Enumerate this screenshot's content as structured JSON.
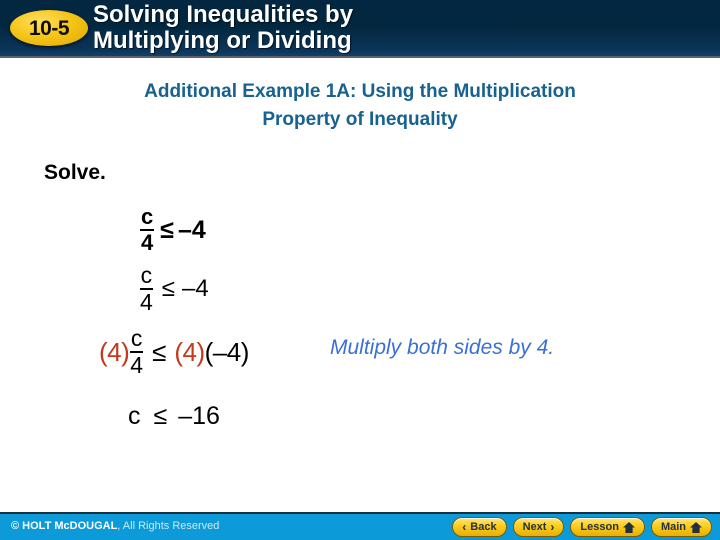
{
  "banner": {
    "lesson_number": "10-5",
    "title_line1": "Solving Inequalities by",
    "title_line2": "Multiplying or Dividing",
    "background_color": "#02273f",
    "badge_color": "#f5c518"
  },
  "heading": {
    "line1": "Additional Example 1A: Using the Multiplication",
    "line2": "Property of Inequality",
    "color": "#17628f"
  },
  "content": {
    "solve_label": "Solve.",
    "steps": [
      {
        "id": "step-1",
        "numerator": "c",
        "denominator": "4",
        "operator": "≤",
        "right": "–4"
      },
      {
        "id": "step-2",
        "numerator": "c",
        "denominator": "4",
        "operator": "≤",
        "right": "–4"
      },
      {
        "id": "step-3",
        "left_multiplier": "(4)",
        "numerator": "c",
        "denominator": "4",
        "operator": "≤",
        "right_multiplier": "(4)",
        "right": "(–4)",
        "multiplier_color": "#c3391a"
      },
      {
        "id": "step-4",
        "variable": "c",
        "operator": "≤",
        "right": "–16"
      }
    ],
    "annotation": "Multiply both sides by 4.",
    "annotation_color": "#3a6fd8"
  },
  "footer": {
    "copyright_strong": "© HOLT McDOUGAL",
    "copyright_rest": ", All Rights Reserved",
    "background_color": "#0c9ad8",
    "buttons": [
      {
        "label": "Back",
        "icon": "chevron-left-icon",
        "glyph": "‹",
        "icon_side": "left"
      },
      {
        "label": "Next",
        "icon": "chevron-right-icon",
        "glyph": "›",
        "icon_side": "right"
      },
      {
        "label": "Lesson",
        "icon": "home-icon",
        "glyph": "",
        "icon_side": "right"
      },
      {
        "label": "Main",
        "icon": "home-icon",
        "glyph": "",
        "icon_side": "right"
      }
    ]
  }
}
